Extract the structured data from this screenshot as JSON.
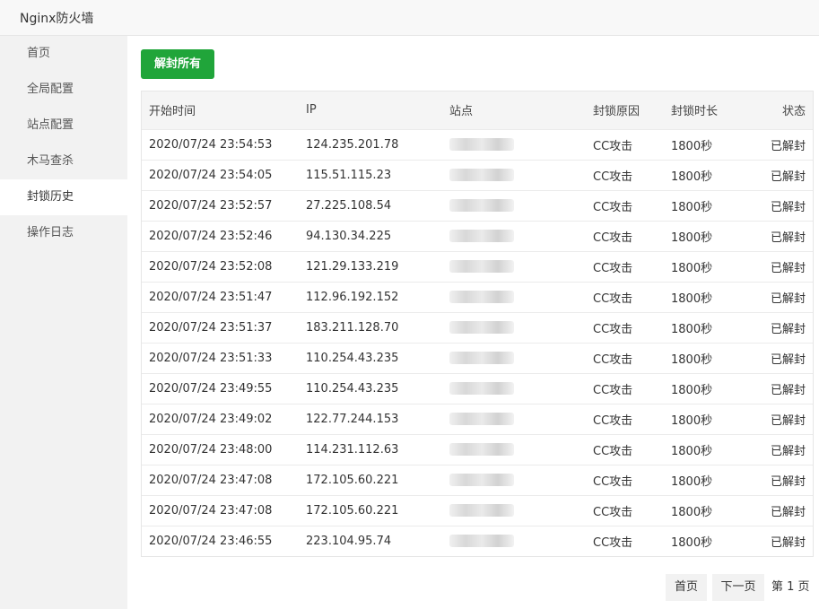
{
  "window": {
    "title": "Nginx防火墙"
  },
  "sidebar": {
    "items": [
      {
        "label": "首页"
      },
      {
        "label": "全局配置"
      },
      {
        "label": "站点配置"
      },
      {
        "label": "木马查杀"
      },
      {
        "label": "封锁历史"
      },
      {
        "label": "操作日志"
      }
    ],
    "active_index": 4
  },
  "toolbar": {
    "unban_all_label": "解封所有"
  },
  "table": {
    "headers": [
      "开始时间",
      "IP",
      "站点",
      "封锁原因",
      "封锁时长",
      "状态"
    ],
    "rows": [
      {
        "time": "2020/07/24 23:54:53",
        "ip": "124.235.201.78",
        "site": "",
        "reason": "CC攻击",
        "duration": "1800秒",
        "status": "已解封"
      },
      {
        "time": "2020/07/24 23:54:05",
        "ip": "115.51.115.23",
        "site": "",
        "reason": "CC攻击",
        "duration": "1800秒",
        "status": "已解封"
      },
      {
        "time": "2020/07/24 23:52:57",
        "ip": "27.225.108.54",
        "site": "",
        "reason": "CC攻击",
        "duration": "1800秒",
        "status": "已解封"
      },
      {
        "time": "2020/07/24 23:52:46",
        "ip": "94.130.34.225",
        "site": "",
        "reason": "CC攻击",
        "duration": "1800秒",
        "status": "已解封"
      },
      {
        "time": "2020/07/24 23:52:08",
        "ip": "121.29.133.219",
        "site": "",
        "reason": "CC攻击",
        "duration": "1800秒",
        "status": "已解封"
      },
      {
        "time": "2020/07/24 23:51:47",
        "ip": "112.96.192.152",
        "site": "",
        "reason": "CC攻击",
        "duration": "1800秒",
        "status": "已解封"
      },
      {
        "time": "2020/07/24 23:51:37",
        "ip": "183.211.128.70",
        "site": "",
        "reason": "CC攻击",
        "duration": "1800秒",
        "status": "已解封"
      },
      {
        "time": "2020/07/24 23:51:33",
        "ip": "110.254.43.235",
        "site": "",
        "reason": "CC攻击",
        "duration": "1800秒",
        "status": "已解封"
      },
      {
        "time": "2020/07/24 23:49:55",
        "ip": "110.254.43.235",
        "site": "",
        "reason": "CC攻击",
        "duration": "1800秒",
        "status": "已解封"
      },
      {
        "time": "2020/07/24 23:49:02",
        "ip": "122.77.244.153",
        "site": "",
        "reason": "CC攻击",
        "duration": "1800秒",
        "status": "已解封"
      },
      {
        "time": "2020/07/24 23:48:00",
        "ip": "114.231.112.63",
        "site": "",
        "reason": "CC攻击",
        "duration": "1800秒",
        "status": "已解封"
      },
      {
        "time": "2020/07/24 23:47:08",
        "ip": "172.105.60.221",
        "site": "",
        "reason": "CC攻击",
        "duration": "1800秒",
        "status": "已解封"
      },
      {
        "time": "2020/07/24 23:47:08",
        "ip": "172.105.60.221",
        "site": "",
        "reason": "CC攻击",
        "duration": "1800秒",
        "status": "已解封"
      },
      {
        "time": "2020/07/24 23:46:55",
        "ip": "223.104.95.74",
        "site": "",
        "reason": "CC攻击",
        "duration": "1800秒",
        "status": "已解封"
      }
    ]
  },
  "pagination": {
    "first_label": "首页",
    "next_label": "下一页",
    "page_text": "第 1 页"
  },
  "colors": {
    "primary_button": "#20a53a",
    "sidebar_bg": "#f2f2f2"
  }
}
